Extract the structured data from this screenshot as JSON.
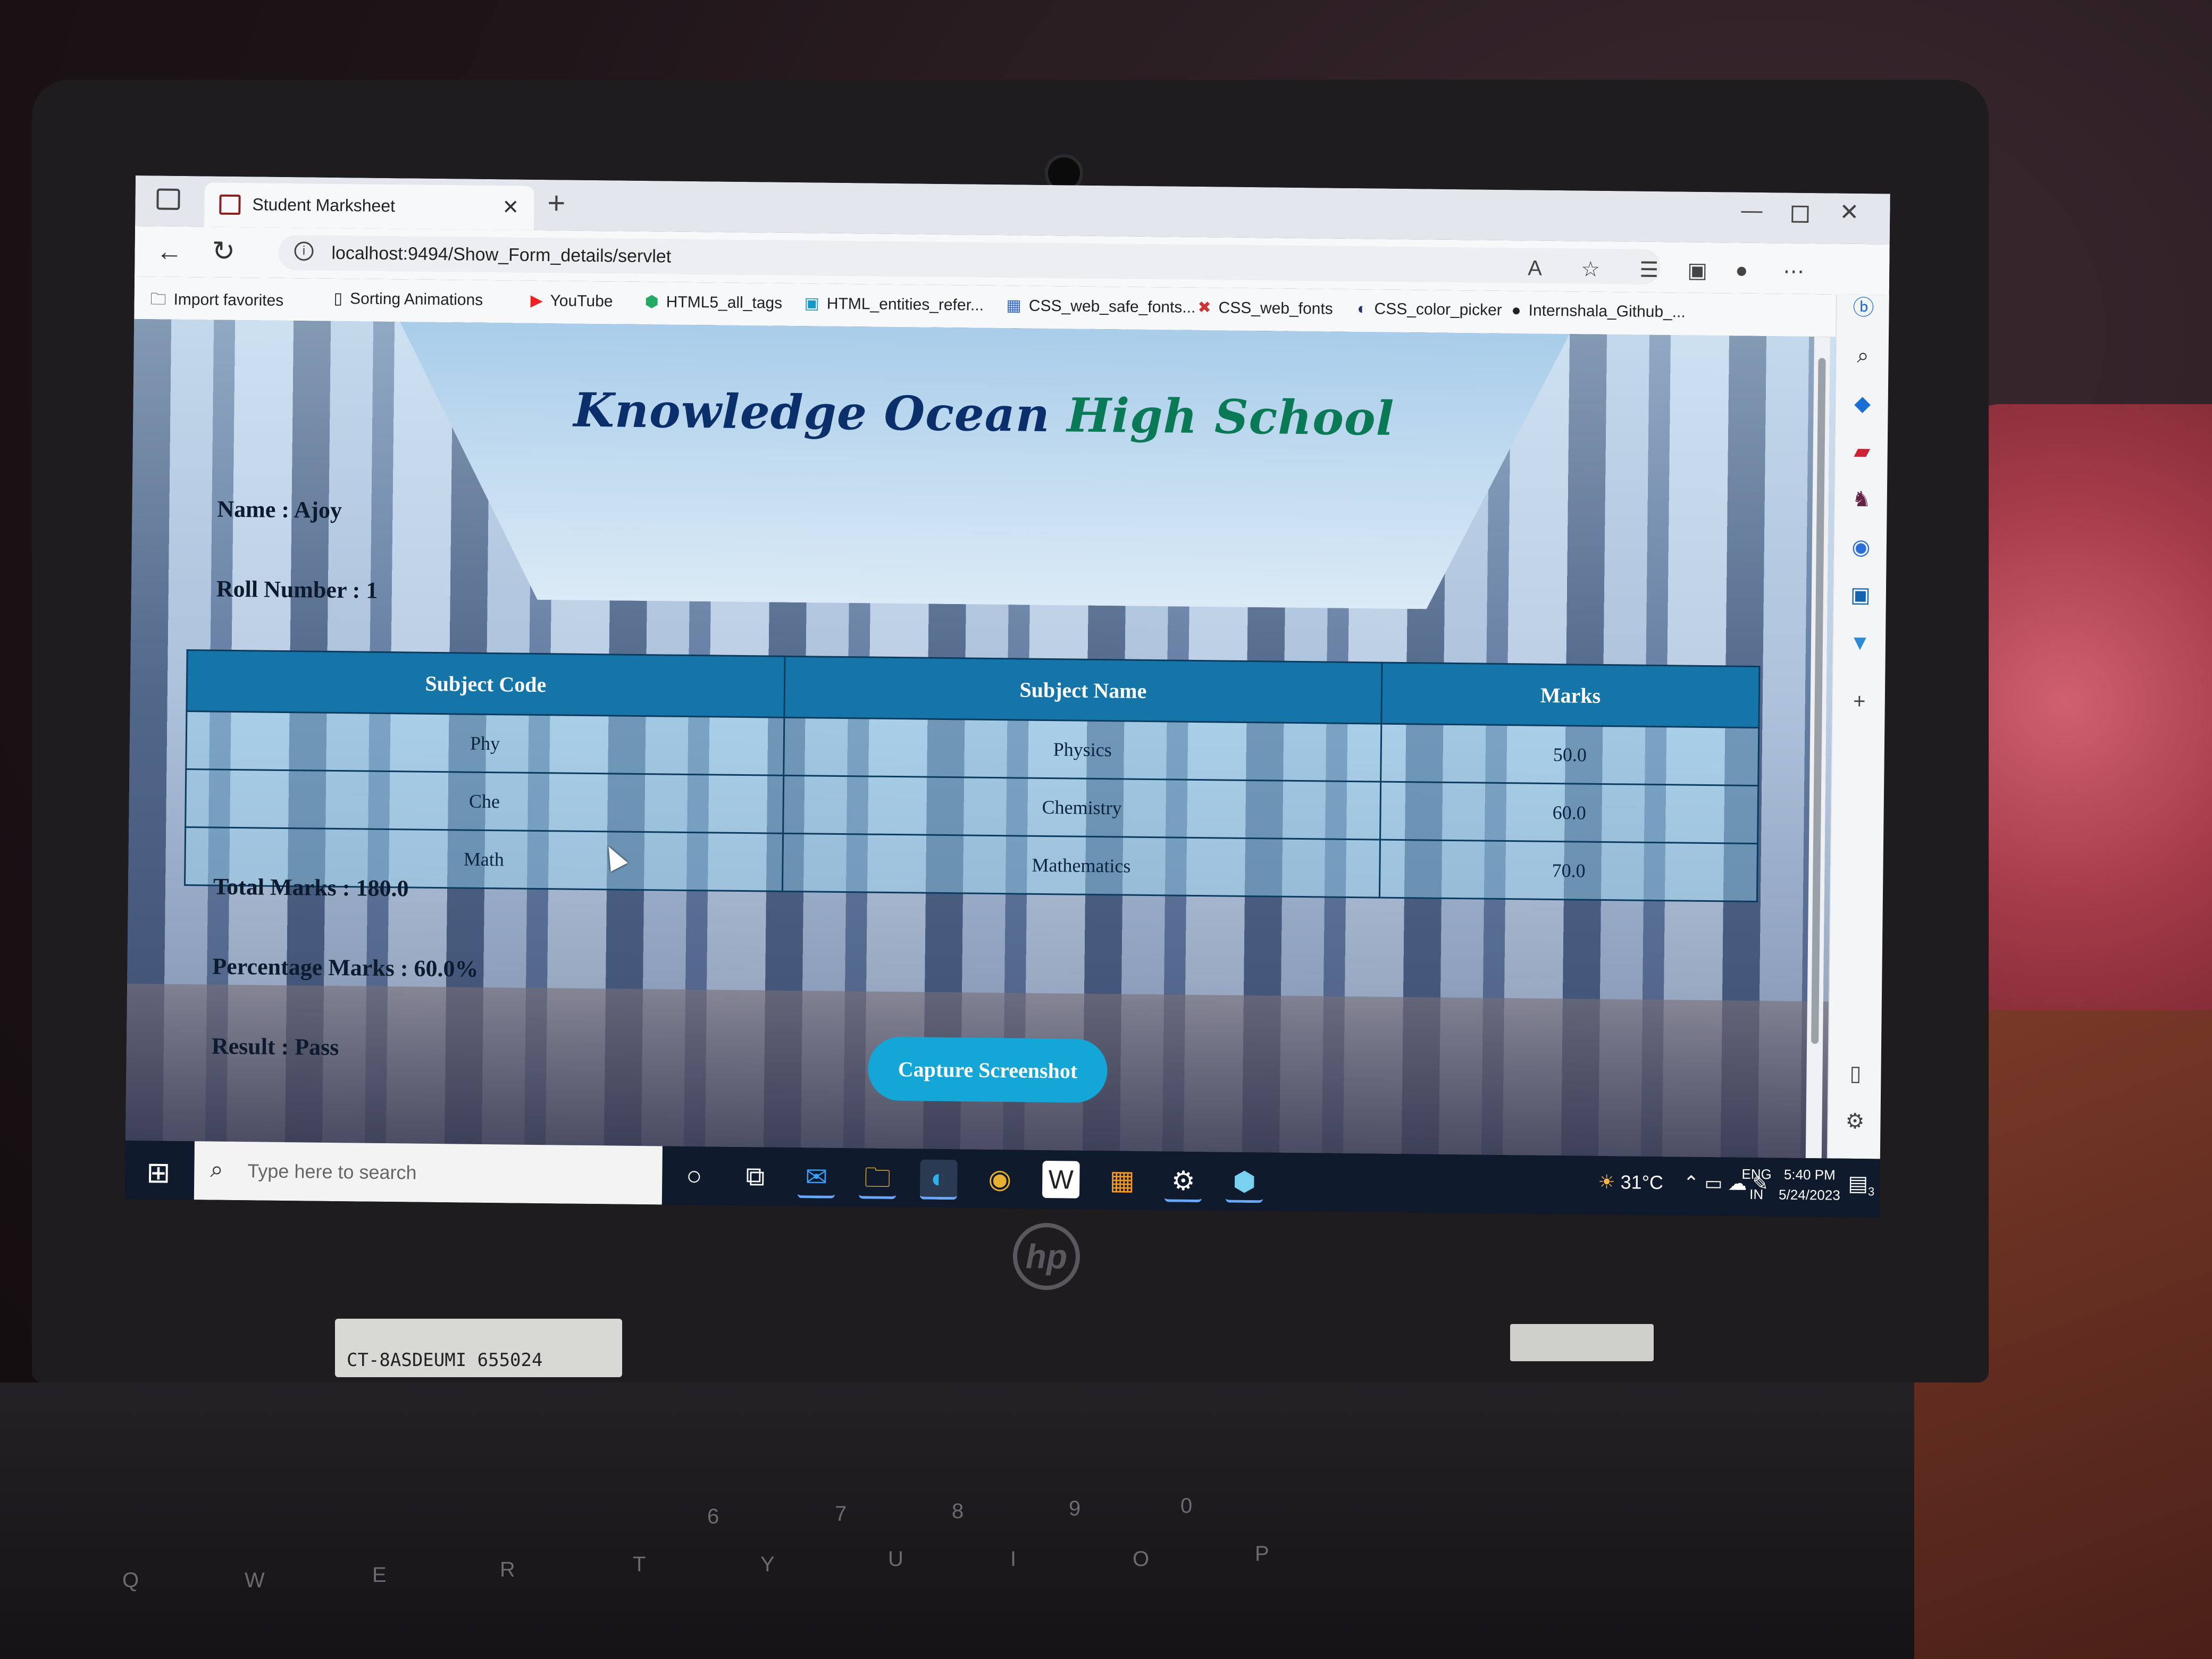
{
  "browser": {
    "tab_title": "Student Marksheet",
    "tab_close": "✕",
    "new_tab": "+",
    "url": "localhost:9494/Show_Form_details/servlet",
    "bookmarks": [
      {
        "icon": "folder-icon",
        "label": "Import favorites"
      },
      {
        "icon": "page-icon",
        "label": "Sorting Animations"
      },
      {
        "icon": "youtube-icon",
        "label": "YouTube"
      },
      {
        "icon": "html5-icon",
        "label": "HTML5_all_tags"
      },
      {
        "icon": "bookmark-icon",
        "label": "HTML_entities_refer..."
      },
      {
        "icon": "bookmark-icon",
        "label": "CSS_web_safe_fonts..."
      },
      {
        "icon": "bookmark-icon",
        "label": "CSS_web_fonts"
      },
      {
        "icon": "bookmark-icon",
        "label": "CSS_color_picker"
      },
      {
        "icon": "github-icon",
        "label": "Internshala_Github_..."
      }
    ]
  },
  "page": {
    "title_part1": "Knowledge Ocean",
    "title_part2": "High School",
    "name": "Name : Ajoy",
    "roll": "Roll Number : 1",
    "table": {
      "headers": [
        "Subject Code",
        "Subject Name",
        "Marks"
      ],
      "rows": [
        [
          "Phy",
          "Physics",
          "50.0"
        ],
        [
          "Che",
          "Chemistry",
          "60.0"
        ],
        [
          "Math",
          "Mathematics",
          "70.0"
        ]
      ]
    },
    "total": "Total Marks : 180.0",
    "percentage": "Percentage Marks : 60.0%",
    "result": "Result : Pass",
    "capture_button": "Capture Screenshot"
  },
  "taskbar": {
    "search_placeholder": "Type here to search",
    "weather": "31°C",
    "lang_line1": "ENG",
    "lang_line2": "IN",
    "time": "5:40 PM",
    "date": "5/24/2023",
    "notification_count": "3"
  },
  "laptop": {
    "sticker": "CT-8ASDEUMI 655024"
  }
}
